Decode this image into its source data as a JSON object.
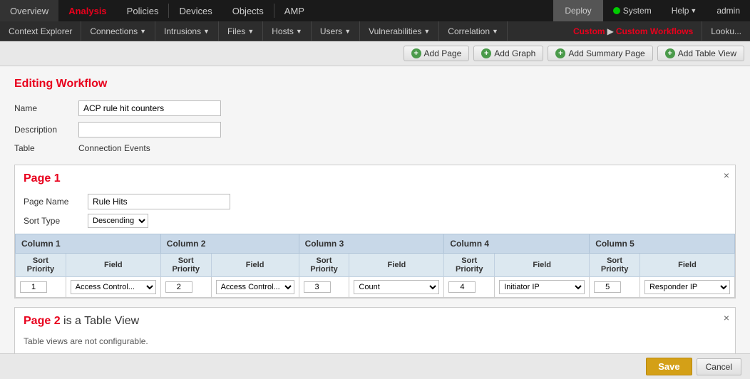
{
  "topNav": {
    "items": [
      {
        "label": "Overview",
        "active": false
      },
      {
        "label": "Analysis",
        "active": true
      },
      {
        "label": "Policies",
        "active": false
      },
      {
        "label": "Devices",
        "active": false
      },
      {
        "label": "Objects",
        "active": false
      },
      {
        "label": "AMP",
        "active": false
      }
    ],
    "rightItems": [
      {
        "label": "Deploy"
      },
      {
        "label": "System"
      },
      {
        "label": "Help"
      },
      {
        "label": "admin"
      }
    ]
  },
  "secondNav": {
    "items": [
      {
        "label": "Context Explorer",
        "hasArrow": false
      },
      {
        "label": "Connections",
        "hasArrow": true
      },
      {
        "label": "Intrusions",
        "hasArrow": true
      },
      {
        "label": "Files",
        "hasArrow": true
      },
      {
        "label": "Hosts",
        "hasArrow": true
      },
      {
        "label": "Users",
        "hasArrow": true
      },
      {
        "label": "Vulnerabilities",
        "hasArrow": true
      },
      {
        "label": "Correlation",
        "hasArrow": true
      }
    ],
    "breadcrumb": {
      "part1": "Custom",
      "sep": "▶",
      "part2": "Custom Workflows"
    },
    "lookup": "Looku..."
  },
  "toolbar": {
    "buttons": [
      {
        "label": "Add Page",
        "icon": "+"
      },
      {
        "label": "Add Graph",
        "icon": "+"
      },
      {
        "label": "Add Summary Page",
        "icon": "+"
      },
      {
        "label": "Add Table View",
        "icon": "+"
      }
    ]
  },
  "editingWorkflow": {
    "title": "Editing Workflow",
    "fields": [
      {
        "label": "Name",
        "value": "ACP rule hit counters",
        "type": "input"
      },
      {
        "label": "Description",
        "value": "",
        "type": "input"
      },
      {
        "label": "Table",
        "value": "Connection Events",
        "type": "text"
      }
    ]
  },
  "page1": {
    "title": "Page 1",
    "pageName": "Rule Hits",
    "sortType": "Descending",
    "columns": [
      {
        "header": "Column 1"
      },
      {
        "header": "Column 2"
      },
      {
        "header": "Column 3"
      },
      {
        "header": "Column 4"
      },
      {
        "header": "Column 5"
      }
    ],
    "subHeaders": [
      "Sort Priority",
      "Field",
      "Sort Priority",
      "Field",
      "Sort Priority",
      "Field",
      "Sort Priority",
      "Field",
      "Sort Priority",
      "Field"
    ],
    "row": [
      {
        "sortPriority": "1",
        "field": "Access Contro..."
      },
      {
        "sortPriority": "2",
        "field": "Access Contro..."
      },
      {
        "sortPriority": "3",
        "field": "Count"
      },
      {
        "sortPriority": "4",
        "field": "Initiator IP"
      },
      {
        "sortPriority": "5",
        "field": "Responder IP"
      }
    ]
  },
  "page2": {
    "title": "Page 2",
    "subtitle": "is a Table View",
    "note": "Table views are not configurable."
  },
  "actions": {
    "save": "Save",
    "cancel": "Cancel"
  }
}
